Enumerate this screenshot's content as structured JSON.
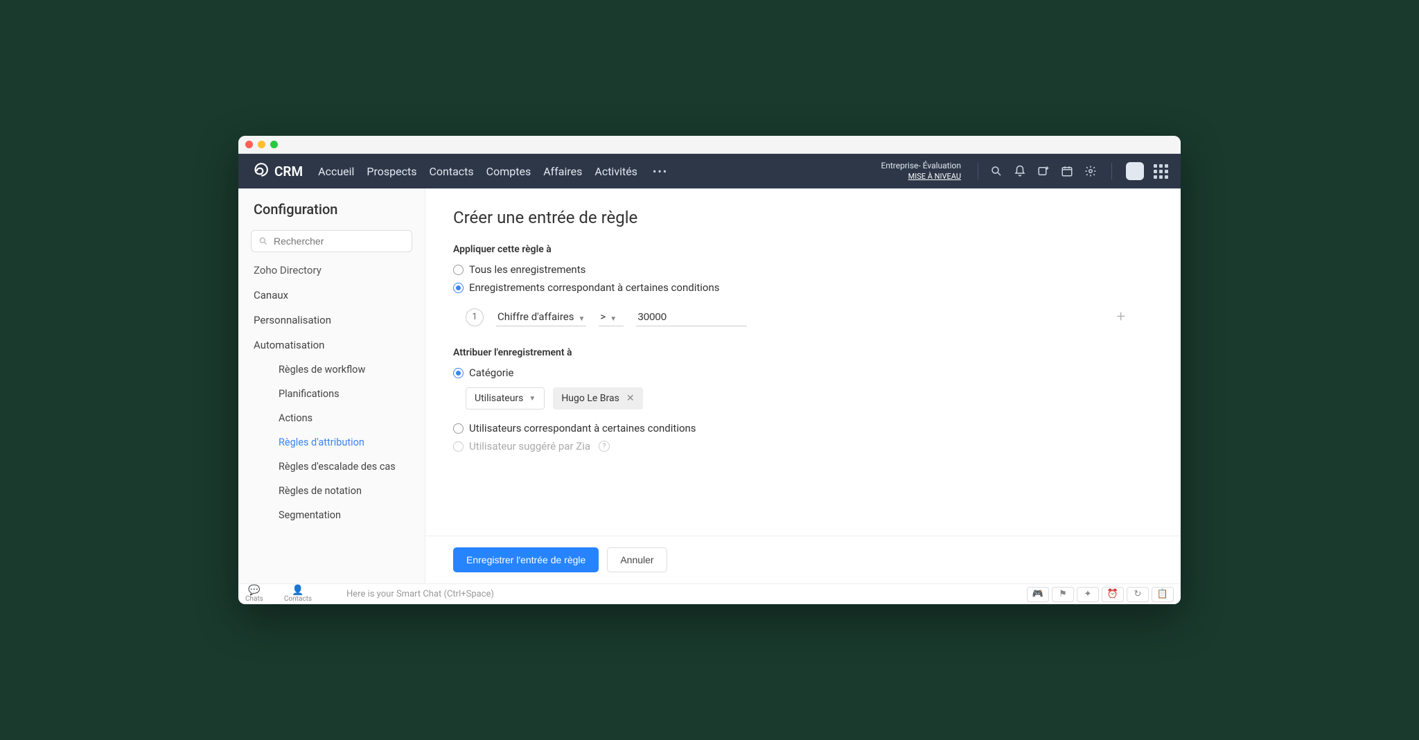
{
  "brand": "CRM",
  "nav": {
    "accueil": "Accueil",
    "prospects": "Prospects",
    "contacts": "Contacts",
    "comptes": "Comptes",
    "affaires": "Affaires",
    "activites": "Activités"
  },
  "trial": {
    "line1": "Entreprise- Évaluation",
    "upgrade": "MISE À NIVEAU"
  },
  "sidebar": {
    "title": "Configuration",
    "search_placeholder": "Rechercher",
    "zoho_directory": "Zoho Directory",
    "canaux": "Canaux",
    "personnalisation": "Personnalisation",
    "automatisation": "Automatisation",
    "sub": {
      "workflow": "Règles de workflow",
      "planifications": "Planifications",
      "actions": "Actions",
      "attribution": "Règles d'attribution",
      "escalade": "Règles d'escalade des cas",
      "notation": "Règles de notation",
      "segmentation": "Segmentation"
    }
  },
  "page": {
    "title": "Créer une entrée de règle",
    "apply_label": "Appliquer cette règle à",
    "apply_all": "Tous les enregistrements",
    "apply_matching": "Enregistrements correspondant à certaines conditions",
    "condition": {
      "num": "1",
      "field": "Chiffre d'affaires",
      "operator": ">",
      "value": "30000"
    },
    "assign_label": "Attribuer l'enregistrement à",
    "assign_category": "Catégorie",
    "assign_type": "Utilisateurs",
    "assign_user": "Hugo Le Bras",
    "assign_matching": "Utilisateurs correspondant à certaines conditions",
    "assign_zia": "Utilisateur suggéré par Zia"
  },
  "footer": {
    "save": "Enregistrer l'entrée de règle",
    "cancel": "Annuler"
  },
  "bottombar": {
    "chats": "Chats",
    "contacts": "Contacts",
    "hint": "Here is your Smart Chat (Ctrl+Space)"
  }
}
